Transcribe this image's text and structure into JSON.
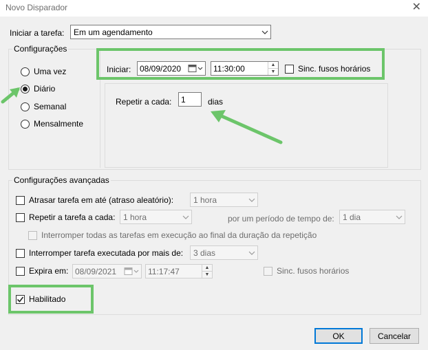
{
  "window": {
    "title": "Novo Disparador",
    "close_glyph": "✕"
  },
  "trigger": {
    "label": "Iniciar a tarefa:",
    "value": "Em um agendamento"
  },
  "settings": {
    "legend": "Configurações",
    "options": [
      "Uma vez",
      "Diário",
      "Semanal",
      "Mensalmente"
    ],
    "selected": "Diário",
    "start_label": "Iniciar:",
    "start_date": "08/09/2020",
    "start_time": "11:30:00",
    "sync_label": "Sinc. fusos horários",
    "repeat_label": "Repetir a cada:",
    "repeat_value": "1",
    "repeat_unit": "dias"
  },
  "advanced": {
    "legend": "Configurações avançadas",
    "delay_label": "Atrasar tarefa em até (atraso aleatório):",
    "delay_value": "1 hora",
    "repeat_label": "Repetir a tarefa a cada:",
    "repeat_value": "1 hora",
    "duration_label": "por um período de tempo de:",
    "duration_value": "1 dia",
    "stop_all_label": "Interromper todas as tarefas em execução ao final da duração da repetição",
    "stop_long_label": "Interromper tarefa executada por mais de:",
    "stop_long_value": "3 dias",
    "expire_label": "Expira em:",
    "expire_date": "08/09/2021",
    "expire_time": "11:17:47",
    "expire_sync_label": "Sinc. fusos horários",
    "enabled_label": "Habilitado"
  },
  "buttons": {
    "ok": "OK",
    "cancel": "Cancelar"
  },
  "colors": {
    "highlight": "#6cc56a",
    "accent": "#0078d7"
  }
}
